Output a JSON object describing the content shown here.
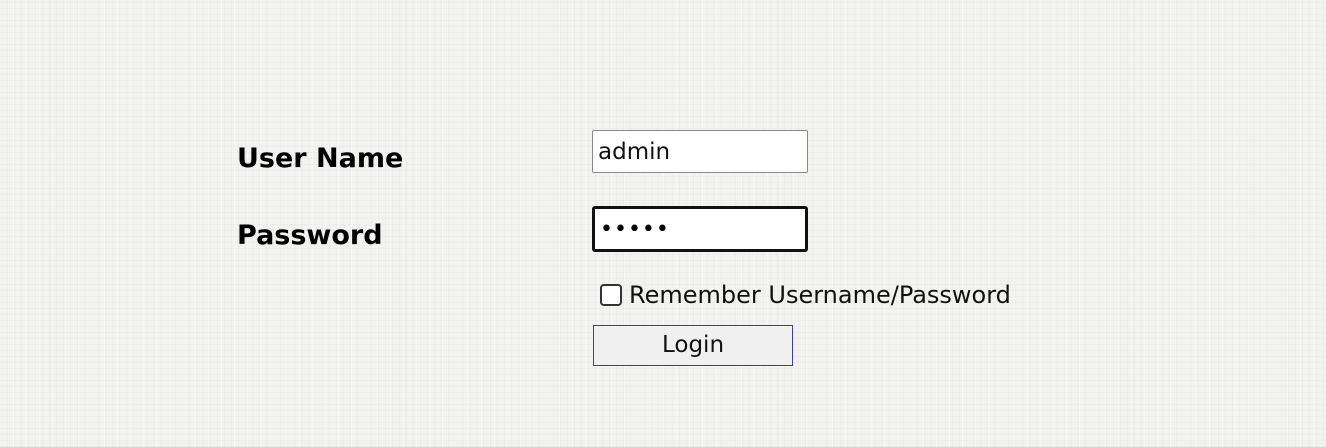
{
  "login": {
    "username_label": "User Name",
    "username_value": "admin",
    "password_label": "Password",
    "password_masked": "•••••",
    "remember_label": "Remember Username/Password",
    "remember_checked": false,
    "login_button": "Login"
  },
  "colors": {
    "page_background": "#f2f2f1",
    "input_border": "#8a8a8a",
    "focused_input_border": "#111111",
    "button_border": "#3d3d9a",
    "button_background": "#f0f0f0"
  }
}
